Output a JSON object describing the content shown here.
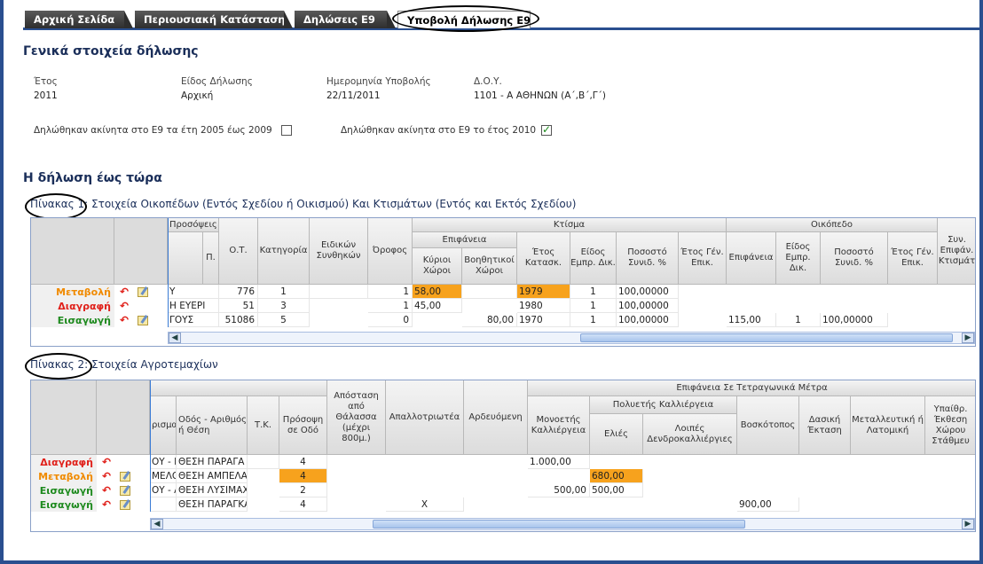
{
  "tabs": [
    {
      "label": "Αρχική Σελίδα"
    },
    {
      "label": "Περιουσιακή Κατάσταση"
    },
    {
      "label": "Δηλώσεις Ε9"
    },
    {
      "label": "Υποβολή Δήλωσης Ε9"
    }
  ],
  "general": {
    "title": "Γενικά στοιχεία δήλωσης",
    "year_label": "Έτος",
    "year_value": "2011",
    "type_label": "Είδος Δήλωσης",
    "type_value": "Αρχική",
    "date_label": "Ημερομηνία Υποβολής",
    "date_value": "22/11/2011",
    "doy_label": "Δ.Ο.Υ.",
    "doy_value": "1101 - Α ΑΘΗΝΩΝ (Α΄,Β΄,Γ΄)",
    "check1_label": "Δηλώθηκαν ακίνητα στο Ε9 τα έτη 2005 έως 2009",
    "check1_checked": false,
    "check2_label": "Δηλώθηκαν ακίνητα στο Ε9 το έτος 2010",
    "check2_checked": true
  },
  "sofar": {
    "title": "Η δήλωση έως τώρα"
  },
  "table1": {
    "caption": "Πίνακας 1: Στοιχεία Οικοπέδων (Εντός Σχεδίου ή Οικισμού) Και Κτισμάτων (Εντός και Εκτός Σχεδίου)",
    "h_prosopseis": "Προσόψεις",
    "h_p": "Π.",
    "h_ot": "Ο.Τ.",
    "h_kat": "Κατηγορία",
    "h_eidikon": "Ειδικών Συνθηκών",
    "h_orofos": "Όροφος",
    "h_ktisma": "Κτίσμα",
    "h_epifaneia": "Επιφάνεια",
    "h_kirioi": "Κύριοι Χώροι",
    "h_voith": "Βοηθητικοί Χώροι",
    "h_etos_kat": "Έτος Κατασκ.",
    "h_eidos_empr": "Είδος Εμπρ. Δικ.",
    "h_pososto": "Ποσοστό Συνιδ. %",
    "h_etos_gen": "Έτος Γέν. Επικ.",
    "h_oikopedo": "Οικόπεδο",
    "h_epif2": "Επιφάνεια",
    "h_eidos2": "Είδος Εμπρ. Δικ.",
    "h_pos2": "Ποσοστό Συνιδ. %",
    "h_etos2": "Έτος Γέν. Επικ.",
    "h_syn": "Συν. Επιφάν. Κτισμάτ",
    "rows": [
      {
        "action": "Μεταβολή",
        "c1": "Υ",
        "ot": "776",
        "kat": "1",
        "orofos": "1",
        "kirioi": "58,00",
        "voith": "",
        "etos": "1979",
        "eidos": "1",
        "pos": "100,00000",
        "epif2": "",
        "eidos2": "",
        "pos2": ""
      },
      {
        "action": "Διαγραφή",
        "c1": "Η ΕΥΕΡΙ",
        "ot": "51",
        "kat": "3",
        "orofos": "1",
        "kirioi": "45,00",
        "voith": "",
        "etos": "1980",
        "eidos": "1",
        "pos": "100,00000",
        "epif2": "",
        "eidos2": "",
        "pos2": ""
      },
      {
        "action": "Εισαγωγή",
        "c1": "ΓΟΥΣ",
        "ot": "51086",
        "kat": "5",
        "orofos": "0",
        "kirioi": "",
        "voith": "80,00",
        "etos": "1970",
        "eidos": "1",
        "pos": "100,00000",
        "epif2": "115,00",
        "eidos2": "1",
        "pos2": "100,00000"
      }
    ]
  },
  "table2": {
    "caption": "Πίνακας 2: Στοιχεία Αγροτεμαχίων",
    "h_rism": "ρισμα",
    "h_odos": "Οδός - Αριθμός ή Θέση",
    "h_tk": "Τ.Κ.",
    "h_prosopsi": "Πρόσοψη σε Οδό",
    "h_apostasi": "Απόσταση από Θάλασσα (μέχρι 800μ.)",
    "h_apallotr": "Απαλλοτριωτέα",
    "h_ardev": "Αρδευόμενη",
    "h_epif_tm": "Επιφάνεια Σε Τετραγωνικά Μέτρα",
    "h_monoeteis": "Μονοετής Καλλιέργεια",
    "h_polyeteis": "Πολυετής Καλλιέργεια",
    "h_elies": "Ελιές",
    "h_loipes": "Λοιπές Δενδροκαλλιέργιες",
    "h_voskot": "Βοσκότοπος",
    "h_dasiki": "Δασική Έκταση",
    "h_metall": "Μεταλλευτική ή Λατομική",
    "h_ypaith": "Υπαίθρ. Έκθεση Χώρου Στάθμευ",
    "rows": [
      {
        "action": "Διαγραφή",
        "c1": "ΟΥ - Κ.",
        "odos": "ΘΕΣΗ ΠΑΡΑΓΑ",
        "pros": "4",
        "apall": "",
        "mono": "1.000,00",
        "elies": "",
        "vosk": ""
      },
      {
        "action": "Μεταβολή",
        "c1": "ΜΕΛΟΙ",
        "odos": "ΘΕΣΗ ΑΜΠΕΛΑ",
        "pros": "4",
        "apall": "",
        "mono": "",
        "elies": "680,00",
        "vosk": ""
      },
      {
        "action": "Εισαγωγή",
        "c1": "ΟΥ - Λ",
        "odos": "ΘΕΣΗ ΛΥΣΙΜΑΧ",
        "pros": "2",
        "apall": "",
        "mono": "500,00",
        "elies": "500,00",
        "vosk": ""
      },
      {
        "action": "Εισαγωγή",
        "c1": "",
        "odos": "ΘΕΣΗ ΠΑΡΑΓΚΑ",
        "pros": "4",
        "apall": "Χ",
        "mono": "",
        "elies": "",
        "vosk": "900,00"
      }
    ]
  }
}
